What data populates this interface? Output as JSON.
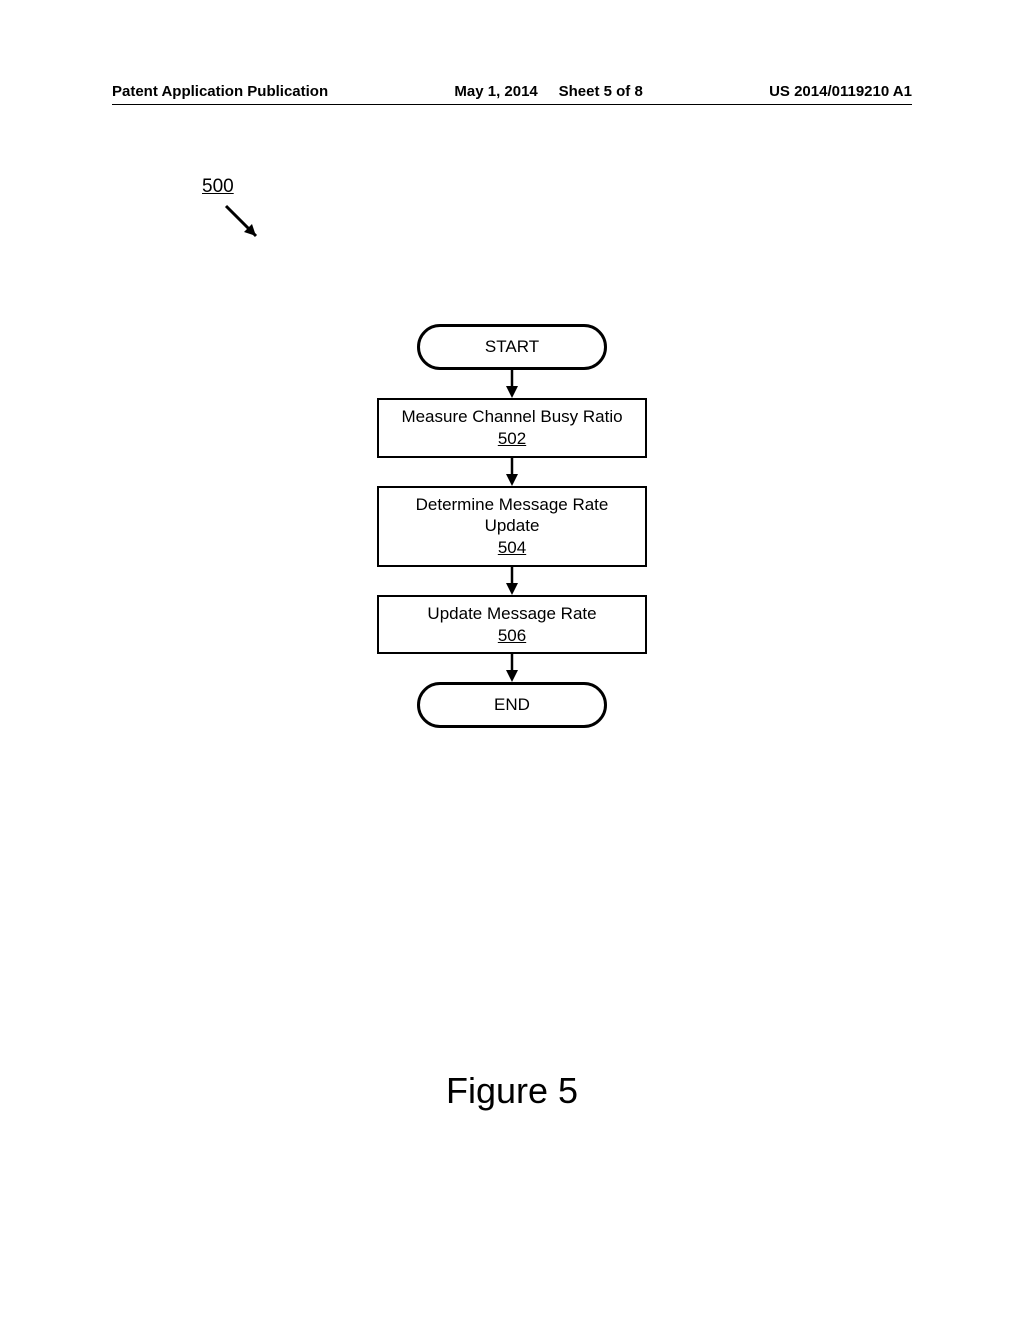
{
  "header": {
    "left": "Patent Application Publication",
    "center_date": "May 1, 2014",
    "center_sheet": "Sheet 5 of 8",
    "right": "US 2014/0119210 A1"
  },
  "figure": {
    "ref_number": "500",
    "label": "Figure 5"
  },
  "flowchart": {
    "start": "START",
    "end": "END",
    "steps": [
      {
        "text": "Measure Channel Busy Ratio",
        "ref": "502"
      },
      {
        "text": "Determine Message Rate Update",
        "ref": "504"
      },
      {
        "text": "Update Message Rate",
        "ref": "506"
      }
    ]
  }
}
